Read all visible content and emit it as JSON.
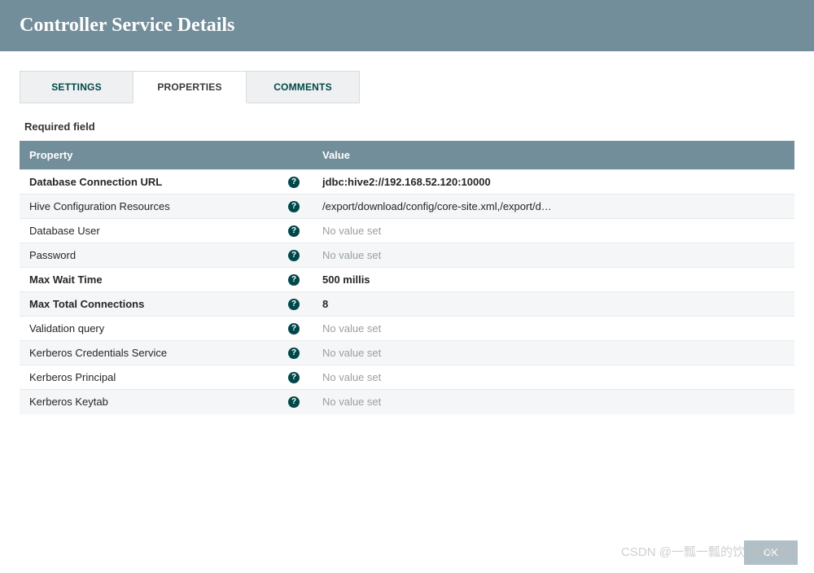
{
  "header": {
    "title": "Controller Service Details"
  },
  "tabs": [
    {
      "label": "SETTINGS",
      "active": false
    },
    {
      "label": "PROPERTIES",
      "active": true
    },
    {
      "label": "COMMENTS",
      "active": false
    }
  ],
  "required_label": "Required field",
  "table": {
    "header_property": "Property",
    "header_value": "Value",
    "no_value_text": "No value set"
  },
  "properties": [
    {
      "name": "Database Connection URL",
      "required": true,
      "value": "jdbc:hive2://192.168.52.120:10000",
      "has_value": true
    },
    {
      "name": "Hive Configuration Resources",
      "required": false,
      "value": "/export/download/config/core-site.xml,/export/d…",
      "has_value": true
    },
    {
      "name": "Database User",
      "required": false,
      "value": null,
      "has_value": false
    },
    {
      "name": "Password",
      "required": false,
      "value": null,
      "has_value": false
    },
    {
      "name": "Max Wait Time",
      "required": true,
      "value": "500 millis",
      "has_value": true
    },
    {
      "name": "Max Total Connections",
      "required": true,
      "value": "8",
      "has_value": true
    },
    {
      "name": "Validation query",
      "required": false,
      "value": null,
      "has_value": false
    },
    {
      "name": "Kerberos Credentials Service",
      "required": false,
      "value": null,
      "has_value": false
    },
    {
      "name": "Kerberos Principal",
      "required": false,
      "value": null,
      "has_value": false
    },
    {
      "name": "Kerberos Keytab",
      "required": false,
      "value": null,
      "has_value": false
    }
  ],
  "buttons": {
    "ok": "OK"
  },
  "watermark": "CSDN @一瓢一瓢的饮 alanchan"
}
